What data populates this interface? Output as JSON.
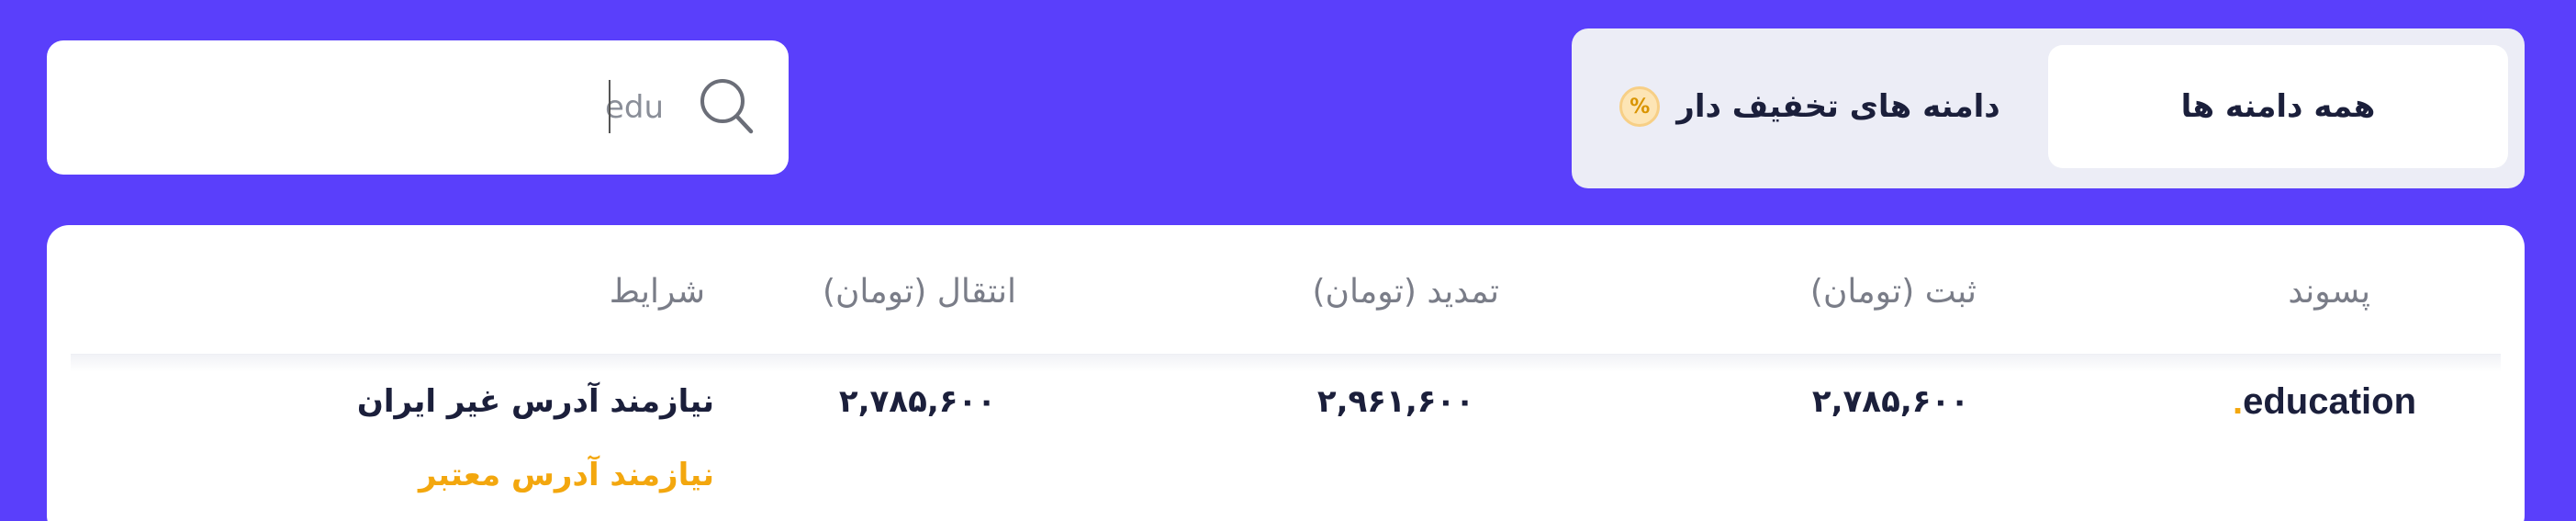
{
  "tabs": {
    "all_domains": "همه دامنه ها",
    "discounted_domains": "دامنه های تخفیف دار",
    "discount_badge": "%"
  },
  "search": {
    "value": "edu",
    "icon": "search-icon"
  },
  "table": {
    "headers": {
      "extension": "پسوند",
      "register": "ثبت (تومان)",
      "renew": "تمدید (تومان)",
      "transfer": "انتقال (تومان)",
      "conditions": "شرایط"
    },
    "rows": [
      {
        "dot": ".",
        "extension": "education",
        "register": "۲,۷۸۵,۶۰۰",
        "renew": "۲,۹۶۱,۶۰۰",
        "transfer": "۲,۷۸۵,۶۰۰",
        "condition_1": "نیازمند آدرس غیر ایران",
        "condition_2": "نیازمند آدرس معتبر"
      }
    ]
  },
  "colors": {
    "background": "#5a3ffb",
    "accent": "#f3a70e",
    "text": "#1b1f3b"
  }
}
